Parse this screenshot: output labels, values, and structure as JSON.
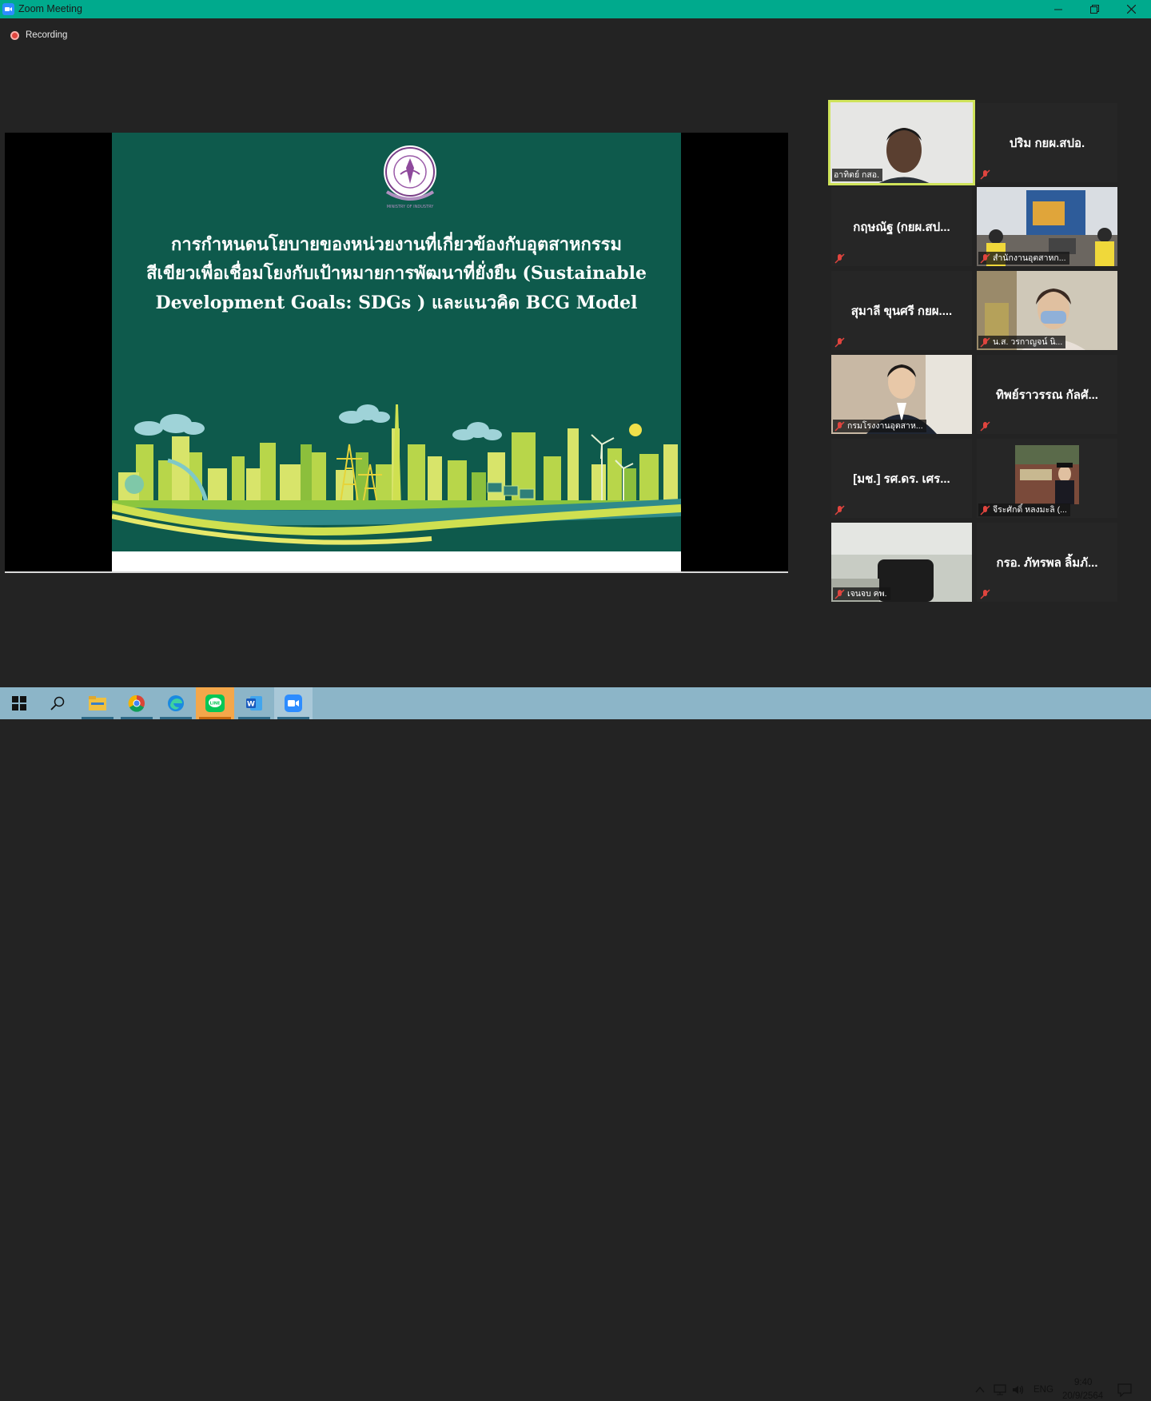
{
  "window": {
    "title": "Zoom Meeting"
  },
  "recording": {
    "label": "Recording"
  },
  "slide": {
    "title_line1": "การกำหนดนโยบายของหน่วยงานที่เกี่ยวข้องกับอุตสาหกรรม",
    "title_line2": "สีเขียวเพื่อเชื่อมโยงกับเป้าหมายการพัฒนาที่ยั่งยืน (Sustainable",
    "title_line3": "Development Goals: SDGs ) และแนวคิด  BCG Model",
    "colors": {
      "background": "#0e5a4c",
      "text": "#ffffff"
    }
  },
  "participants": [
    {
      "label": "อาทิตย์ กสอ.",
      "type": "video",
      "active": true,
      "muted": false
    },
    {
      "name": "ปริม กยผ.สปอ.",
      "type": "name",
      "muted": true
    },
    {
      "name": "กฤษณัฐ (กยผ.สป...",
      "type": "name",
      "muted": true
    },
    {
      "label": "สำนักงานอุตสาหก...",
      "type": "video",
      "muted": true
    },
    {
      "name": "สุมาลี ขุนศรี กยผ....",
      "type": "name",
      "muted": true
    },
    {
      "label": "น.ส. วรกาญจน์ นิ...",
      "type": "video",
      "muted": true
    },
    {
      "label": "กรมโรงงานอุตสาห...",
      "type": "video",
      "muted": true
    },
    {
      "name": "ทิพย์ราวรรณ กัลศั...",
      "type": "name",
      "muted": true
    },
    {
      "name": "[มช.] รศ.ดร. เศร...",
      "type": "name",
      "muted": true
    },
    {
      "label": "จีระศักดิ์ หลงมะลิ (...",
      "type": "video",
      "muted": true
    },
    {
      "label": "เจนจบ คพ.",
      "type": "video",
      "muted": true
    },
    {
      "name": "กรอ. ภัทรพล ลิ้มภั...",
      "type": "name",
      "muted": true
    }
  ],
  "taskbar": {
    "apps": [
      "start-icon",
      "search-icon",
      "file-explorer-icon",
      "chrome-icon",
      "edge-icon",
      "line-icon",
      "word-icon",
      "zoom-icon"
    ],
    "language": "ENG",
    "time": "9:40",
    "date": "20/9/2564"
  }
}
